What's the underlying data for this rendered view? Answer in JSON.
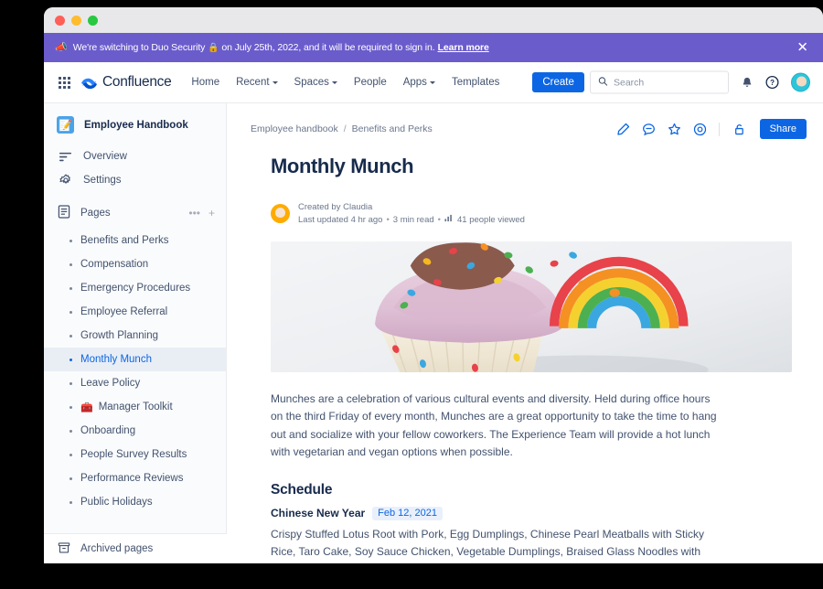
{
  "window": {
    "traffic_lights": [
      "close",
      "minimize",
      "maximize"
    ]
  },
  "banner": {
    "megaphone_icon": "megaphone-icon",
    "text_before": "We're switching to Duo Security",
    "lock_emoji": "🔒",
    "text_after": "on July 25th, 2022, and it will be required to sign in.",
    "link_label": "Learn more",
    "close_label": "✕",
    "background_color": "#6b5ccc"
  },
  "topnav": {
    "app_switcher_icon": "app-switcher-grid-icon",
    "brand_name": "Confluence",
    "brand_logo_icon": "confluence-logo-icon",
    "links": [
      {
        "label": "Home",
        "has_caret": false
      },
      {
        "label": "Recent",
        "has_caret": true
      },
      {
        "label": "Spaces",
        "has_caret": true
      },
      {
        "label": "People",
        "has_caret": false
      },
      {
        "label": "Apps",
        "has_caret": true
      },
      {
        "label": "Templates",
        "has_caret": false
      }
    ],
    "create_label": "Create",
    "create_color": "#0c66e4",
    "search": {
      "placeholder": "Search",
      "value": "",
      "icon": "search-icon"
    },
    "notification_icon": "notification-bell-icon",
    "help_icon": "help-question-icon",
    "avatar_icon": "user-avatar",
    "avatar_color": "#2ec4d9"
  },
  "sidebar": {
    "space": {
      "icon_emoji": "📝",
      "name": "Employee Handbook"
    },
    "nav": [
      {
        "label": "Overview",
        "icon": "overview-lines-icon"
      },
      {
        "label": "Settings",
        "icon": "gear-icon"
      }
    ],
    "pages_section": {
      "label": "Pages",
      "icon": "pages-document-icon",
      "more_label": "•••",
      "add_label": "+"
    },
    "pages": [
      {
        "label": "Benefits and Perks",
        "active": false,
        "emoji": ""
      },
      {
        "label": "Compensation",
        "active": false,
        "emoji": ""
      },
      {
        "label": "Emergency Procedures",
        "active": false,
        "emoji": ""
      },
      {
        "label": "Employee Referral",
        "active": false,
        "emoji": ""
      },
      {
        "label": "Growth Planning",
        "active": false,
        "emoji": ""
      },
      {
        "label": "Monthly Munch",
        "active": true,
        "emoji": ""
      },
      {
        "label": "Leave Policy",
        "active": false,
        "emoji": ""
      },
      {
        "label": "Manager Toolkit",
        "active": false,
        "emoji": "🧰"
      },
      {
        "label": "Onboarding",
        "active": false,
        "emoji": ""
      },
      {
        "label": "People Survey Results",
        "active": false,
        "emoji": ""
      },
      {
        "label": "Performance Reviews",
        "active": false,
        "emoji": ""
      },
      {
        "label": "Public Holidays",
        "active": false,
        "emoji": ""
      }
    ],
    "archived": {
      "label": "Archived pages",
      "icon": "archive-box-icon"
    }
  },
  "page": {
    "breadcrumb": [
      {
        "label": "Employee handbook"
      },
      {
        "label": "Benefits and Perks"
      }
    ],
    "breadcrumb_separator": "/",
    "actions": [
      {
        "name": "edit-pencil-icon",
        "title": "Edit"
      },
      {
        "name": "comment-icon",
        "title": "Comment"
      },
      {
        "name": "star-icon",
        "title": "Favorite"
      },
      {
        "name": "watch-eye-icon",
        "title": "Watch"
      },
      {
        "name": "restrictions-lock-icon",
        "title": "Restrictions"
      }
    ],
    "share_label": "Share",
    "title": "Monthly Munch",
    "byline": {
      "created_by": "Created by Claudia",
      "last_updated": "Last updated 4 hr ago",
      "read_time": "3 min read",
      "views": "41 people viewed",
      "views_icon": "analytics-chart-icon",
      "separator": "•"
    },
    "hero_image_alt": "Cupcake with pink frosting, rainbow candy and sprinkles",
    "paragraph": "Munches are a celebration of various cultural events and diversity. Held during office hours on the third Friday of every month, Munches are a great opportunity to take the time to hang out and socialize with your fellow coworkers. The Experience Team will provide a hot lunch with vegetarian and vegan options when possible.",
    "schedule_heading": "Schedule",
    "schedule": [
      {
        "event": "Chinese New Year",
        "date": "Feb 12, 2021",
        "menu": "Crispy Stuffed Lotus Root with Pork, Egg Dumplings, Chinese Pearl Meatballs with Sticky Rice, Taro Cake, Soy Sauce Chicken, Vegetable Dumplings, Braised Glass Noodles with Napa Cabbage"
      }
    ]
  }
}
